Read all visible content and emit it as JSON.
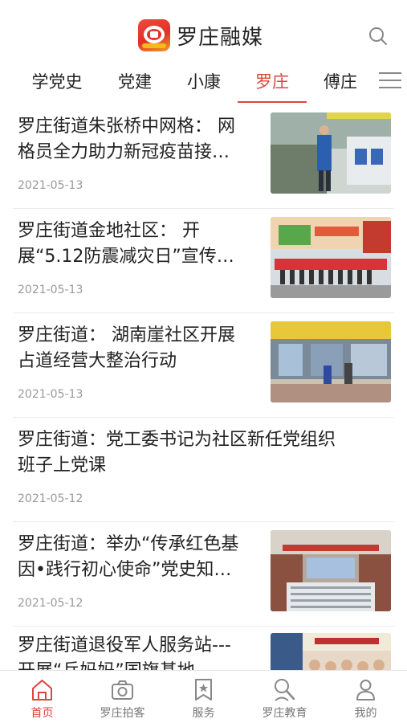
{
  "app": {
    "title": "罗庄融媒"
  },
  "tabs": [
    {
      "label": "学党史"
    },
    {
      "label": "党建"
    },
    {
      "label": "小康"
    },
    {
      "label": "罗庄"
    },
    {
      "label": "傅庄"
    }
  ],
  "active_tab": "罗庄",
  "articles": [
    {
      "title_line1": "罗庄街道朱张桥中网格： 网",
      "title_line2": "格员全力助力新冠疫苗接…",
      "date": "2021-05-13",
      "has_image": true
    },
    {
      "title_line1": "罗庄街道金地社区： 开",
      "title_line2": "展“5.12防震减灾日”宣传…",
      "date": "2021-05-13",
      "has_image": true
    },
    {
      "title_line1": "罗庄街道： 湖南崖社区开展",
      "title_line2": "占道经营大整治行动",
      "date": "2021-05-13",
      "has_image": true
    },
    {
      "title_line1": "罗庄街道：党工委书记为社区新任党组织",
      "title_line2": "班子上党课",
      "date": "2021-05-12",
      "has_image": false
    },
    {
      "title_line1": "罗庄街道：举办“传承红色基",
      "title_line2": "因•践行初心使命”党史知…",
      "date": "2021-05-12",
      "has_image": true
    },
    {
      "title_line1": "罗庄街道退役军人服务站---",
      "title_line2": "开展“兵妈妈”国旗基地",
      "date": "",
      "has_image": true
    }
  ],
  "bottom_nav": [
    {
      "label": "首页",
      "icon": "home-icon",
      "active": true
    },
    {
      "label": "罗庄拍客",
      "icon": "camera-icon",
      "active": false
    },
    {
      "label": "服务",
      "icon": "bookmark-star-icon",
      "active": false
    },
    {
      "label": "罗庄教育",
      "icon": "search-person-icon",
      "active": false
    },
    {
      "label": "我的",
      "icon": "user-icon",
      "active": false
    }
  ],
  "colors": {
    "accent": "#e2433e",
    "text": "#222222",
    "muted": "#999999"
  }
}
